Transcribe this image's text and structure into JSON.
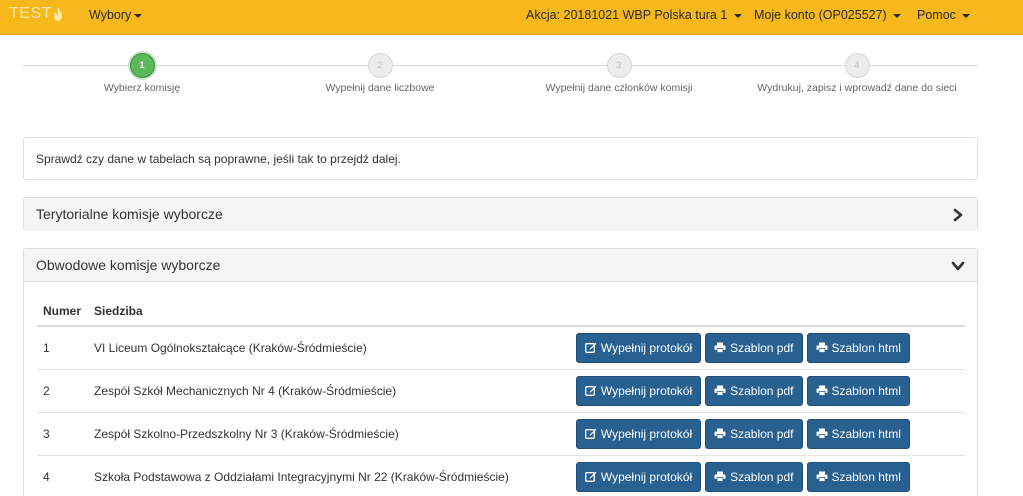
{
  "navbar": {
    "brand": "TEST",
    "menu_elections": "Wybory",
    "menu_action": "Akcja: 20181021 WBP Polska tura 1",
    "menu_account": "Moje konto (OP025527)",
    "menu_help": "Pomoc",
    "bg_color": "#f7b81b"
  },
  "wizard": {
    "steps": [
      {
        "number": "1",
        "label": "Wybierz komisję",
        "active": true
      },
      {
        "number": "2",
        "label": "Wypełnij dane liczbowe",
        "active": false
      },
      {
        "number": "3",
        "label": "Wypełnij dane członków komisji",
        "active": false
      },
      {
        "number": "4",
        "label": "Wydrukuj, zapisz i wprowadź dane do sieci",
        "active": false
      }
    ],
    "active_color": "#5cb85c"
  },
  "info": {
    "text": "Sprawdź czy dane w tabelach są poprawne, jeśli tak to przejdź dalej."
  },
  "panels": {
    "territorial": {
      "title": "Terytorialne komisje wyborcze",
      "icon": "chevron-right-icon"
    },
    "district": {
      "title": "Obwodowe komisje wyborcze",
      "icon": "chevron-down-icon"
    }
  },
  "table": {
    "headers": {
      "number": "Numer",
      "seat": "Siedziba"
    },
    "buttons": {
      "fill": "Wypełnij protokół",
      "pdf": "Szablon pdf",
      "html": "Szablon html"
    },
    "button_color": "#286090",
    "rows": [
      {
        "number": "1",
        "seat": "VI Liceum Ogólnokształcące (Kraków-Śródmieście)"
      },
      {
        "number": "2",
        "seat": "Zespół Szkół Mechanicznych Nr 4 (Kraków-Śródmieście)"
      },
      {
        "number": "3",
        "seat": "Zespół Szkolno-Przedszkolny Nr 3 (Kraków-Śródmieście)"
      },
      {
        "number": "4",
        "seat": "Szkoła Podstawowa z Oddziałami Integracyjnymi Nr 22 (Kraków-Śródmieście)"
      }
    ]
  }
}
